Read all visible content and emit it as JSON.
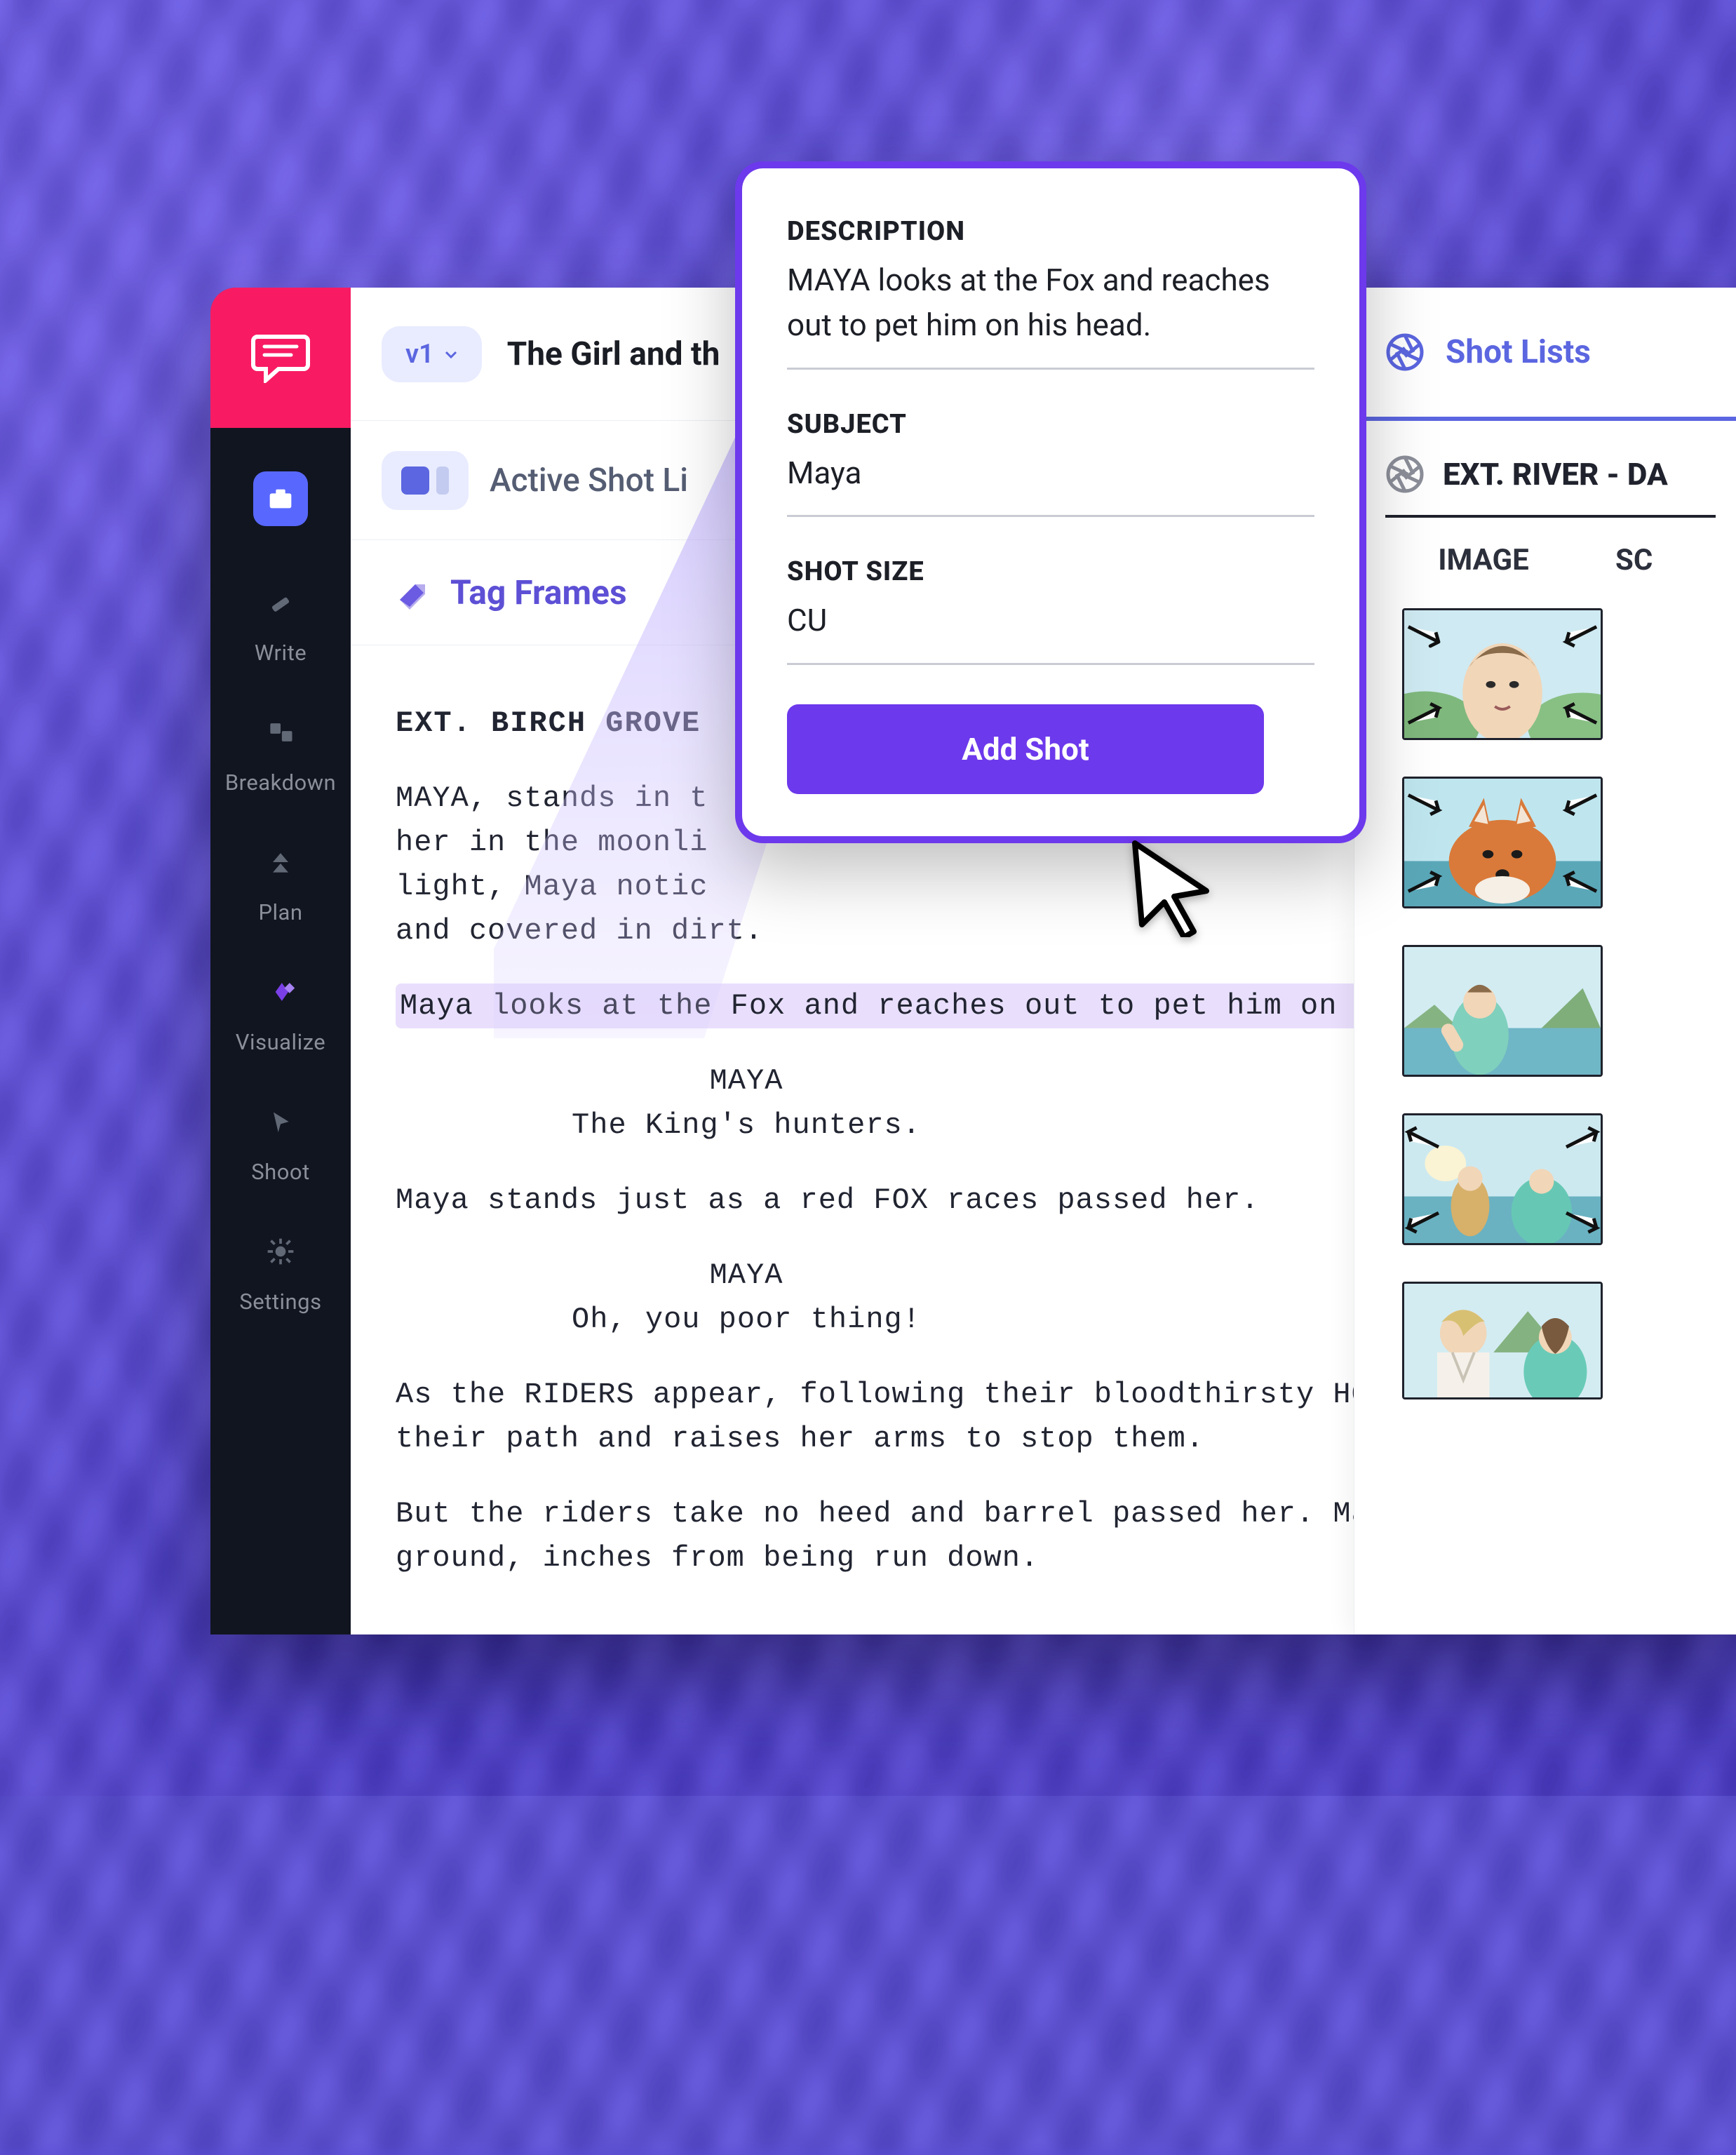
{
  "document": {
    "title": "The Girl and th",
    "version": "v1"
  },
  "sidebar": {
    "items": [
      {
        "label": "Write"
      },
      {
        "label": "Breakdown"
      },
      {
        "label": "Plan"
      },
      {
        "label": "Visualize"
      },
      {
        "label": "Shoot"
      },
      {
        "label": "Settings"
      }
    ]
  },
  "secondary": {
    "active_label": "Active Shot Li"
  },
  "tagbar": {
    "label": "Tag Frames"
  },
  "script": {
    "slugline": "EXT. BIRCH GROVE",
    "p1": "MAYA, stands in t",
    "p1b": "her in the moonli",
    "p1c": "light, Maya notic",
    "p1d": "and covered in dirt.",
    "highlight": "Maya looks at the Fox and reaches out to pet him on his head.",
    "char1": "MAYA",
    "d1": "The King's hunters.",
    "p2": "Maya stands just as a red FOX races passed her.",
    "char2": "MAYA",
    "d2": "Oh, you poor thing!",
    "p3": "As the RIDERS appear, following their bloodthirsty HOUNDS, Maya steps in their path and raises her arms to stop them.",
    "p4": "But the riders take no heed and barrel passed her. Maya drops to the ground, inches from being run down."
  },
  "shotlists": {
    "title": "Shot Lists",
    "scene_slug": "EXT. RIVER - DA",
    "columns": {
      "image": "IMAGE",
      "scene": "SC"
    }
  },
  "modal": {
    "label_description": "DESCRIPTION",
    "description": "MAYA looks at the Fox and reaches out to pet him on his head.",
    "label_subject": "SUBJECT",
    "subject": "Maya",
    "label_shotsize": "SHOT SIZE",
    "shotsize": "CU",
    "add_shot": "Add Shot"
  }
}
